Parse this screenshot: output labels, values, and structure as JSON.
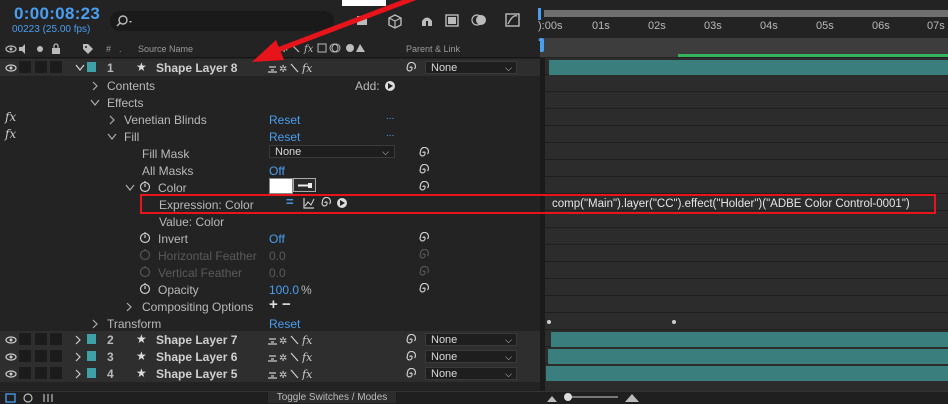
{
  "header": {
    "timecode": "0:00:08:23",
    "fps_label": "00223 (25.00 fps)",
    "search_placeholder": ""
  },
  "columns": {
    "hash": "#",
    "source_name": "Source Name",
    "parent_link": "Parent & Link"
  },
  "ruler": {
    "labels": [
      "):00s",
      "01s",
      "02s",
      "03s",
      "04s",
      "05s",
      "06s",
      "07s"
    ]
  },
  "layers": [
    {
      "num": "1",
      "name": "Shape Layer 8",
      "parent": "None"
    },
    {
      "num": "2",
      "name": "Shape Layer 7",
      "parent": "None"
    },
    {
      "num": "3",
      "name": "Shape Layer 6",
      "parent": "None"
    },
    {
      "num": "4",
      "name": "Shape Layer 5",
      "parent": "None"
    }
  ],
  "props": {
    "contents": "Contents",
    "add": "Add:",
    "effects": "Effects",
    "venetian": "Venetian Blinds",
    "fill": "Fill",
    "reset": "Reset",
    "fill_mask": "Fill Mask",
    "fill_mask_val": "None",
    "all_masks": "All Masks",
    "all_masks_val": "Off",
    "color": "Color",
    "expr_color": "Expression: Color",
    "value_color": "Value: Color",
    "invert": "Invert",
    "invert_val": "Off",
    "hfeather": "Horizontal Feather",
    "hfeather_val": "0.0",
    "vfeather": "Vertical Feather",
    "vfeather_val": "0.0",
    "opacity": "Opacity",
    "opacity_val": "100.0",
    "opacity_unit": "%",
    "compositing": "Compositing Options",
    "transform": "Transform",
    "ellipsis": "..."
  },
  "expression": "comp(\"Main\").layer(\"CC\").effect(\"Holder\")(\"ADBE Color Control-0001\")",
  "footer": {
    "toggle": "Toggle Switches / Modes"
  },
  "colors": {
    "accent": "#4a9ef0",
    "label": "#3fa0a8",
    "annotation": "#e8141c",
    "track": "#3b7e7e"
  }
}
